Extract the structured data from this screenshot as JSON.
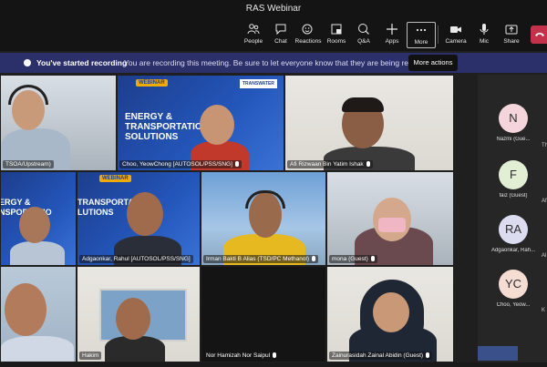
{
  "window": {
    "title": "RAS Webinar"
  },
  "toolbar": {
    "people": "People",
    "chat": "Chat",
    "reactions": "Reactions",
    "rooms": "Rooms",
    "qa": "Q&A",
    "apps": "Apps",
    "more": "More",
    "camera": "Camera",
    "mic": "Mic",
    "share": "Share"
  },
  "banner": {
    "heading": "You've started recording",
    "message": "You are recording this meeting. Be sure to let everyone know that they are being recorded. Pr",
    "tooltip": "More actions"
  },
  "tiles": [
    {
      "name": "TSOA/Upstream)"
    },
    {
      "name": "Choo, YeowChong [AUTOSOL/PSS/SNG]"
    },
    {
      "name": "Afi Rizwaan Bin Yatim Ishak"
    },
    {
      "name": "Adgaonkar, Rahul [AUTOSOL/PSS/SNG]"
    },
    {
      "name": "Irman Bakti B Alias (TSD/PC Methanol)"
    },
    {
      "name": "mona (Guest)"
    },
    {
      "name": "Hakim"
    },
    {
      "name": "Nor Hamizah Nor Saipul"
    },
    {
      "name": "Zainurasidah Zainal Abidin (Guest)"
    }
  ],
  "slides": {
    "badge": "WEBINAR",
    "logo": "TRANSWATER",
    "title_top": "ENERGY &",
    "title_mid": "TRANSPORTATION",
    "title_bot": "SOLUTIONS",
    "title_mid_short": "TRANSPORTATIO",
    "title_bot_short": "LUTIONS",
    "title_top_short": "ERGY &",
    "title_mid_short2": "NSPORTATIO"
  },
  "participants": [
    {
      "initials": "N",
      "name": "Nazmi (Gue...",
      "color": "#f4d5dc"
    },
    {
      "initials": "F",
      "name": "faiz (Guest)",
      "color": "#e3efd4"
    },
    {
      "initials": "RA",
      "name": "Adgaonkar, Rah...",
      "color": "#dcdcf0"
    },
    {
      "initials": "YC",
      "name": "Choo, Yeow...",
      "color": "#f6ddd4"
    }
  ],
  "clipped_labels": [
    "Th",
    "Af",
    "Al",
    "K"
  ]
}
